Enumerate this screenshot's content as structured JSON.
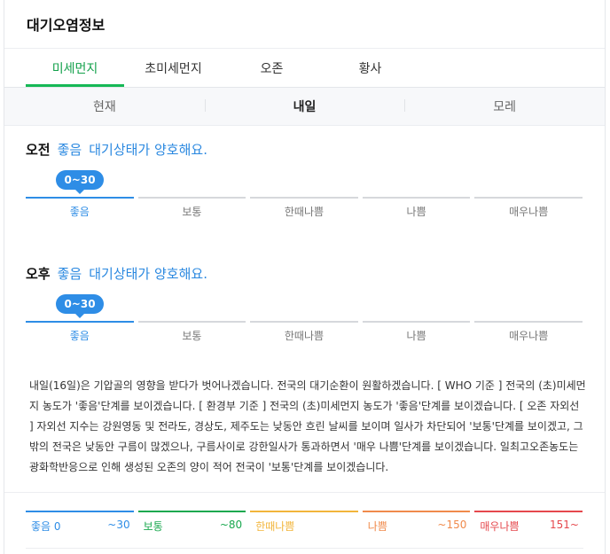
{
  "title": "대기오염정보",
  "tabs": [
    "미세먼지",
    "초미세먼지",
    "오존",
    "황사"
  ],
  "subtabs": [
    "현재",
    "내일",
    "모레"
  ],
  "forecast": [
    {
      "period": "오전",
      "grade": "좋음",
      "desc": "대기상태가 양호해요.",
      "range": "0~30"
    },
    {
      "period": "오후",
      "grade": "좋음",
      "desc": "대기상태가 양호해요.",
      "range": "0~30"
    }
  ],
  "scale_labels": [
    "좋음",
    "보통",
    "한때나쁨",
    "나쁨",
    "매우나쁨"
  ],
  "body": "내일(16일)은 기압골의 영향을 받다가 벗어나겠습니다. 전국의 대기순환이 원활하겠습니다. [ WHO 기준 ] 전국의 (초)미세먼지 농도가 '좋음'단계를 보이겠습니다. [ 환경부 기준 ] 전국의 (초)미세먼지 농도가 '좋음'단계를 보이겠습니다. [ 오존 자외선 ] 자외선 지수는 강원영동 및 전라도, 경상도, 제주도는 낮동안 흐린 날씨를 보이며 일사가 차단되어 '보통'단계를 보이겠고, 그 밖의 전국은 낮동안 구름이 많겠으나, 구름사이로 강한일사가 통과하면서 '매우 나쁨'단계를 보이겠습니다. 일최고오존농도는 광화학반응으로 인해 생성된 오존의 양이 적어 전국이 '보통'단계를 보이겠습니다.",
  "legend": [
    {
      "label": "좋음 0",
      "max": "~30",
      "color": "#2e8de6"
    },
    {
      "label": "보통",
      "max": "~80",
      "color": "#1aa84f"
    },
    {
      "label": "한때나쁨",
      "max": "",
      "color": "#f2b53b"
    },
    {
      "label": "나쁨",
      "max": "~150",
      "color": "#f08a4b"
    },
    {
      "label": "매우나쁨",
      "max": "151~",
      "color": "#e5484d"
    }
  ],
  "colors": {
    "accent_green": "#16b856",
    "accent_blue": "#2e8de6"
  }
}
